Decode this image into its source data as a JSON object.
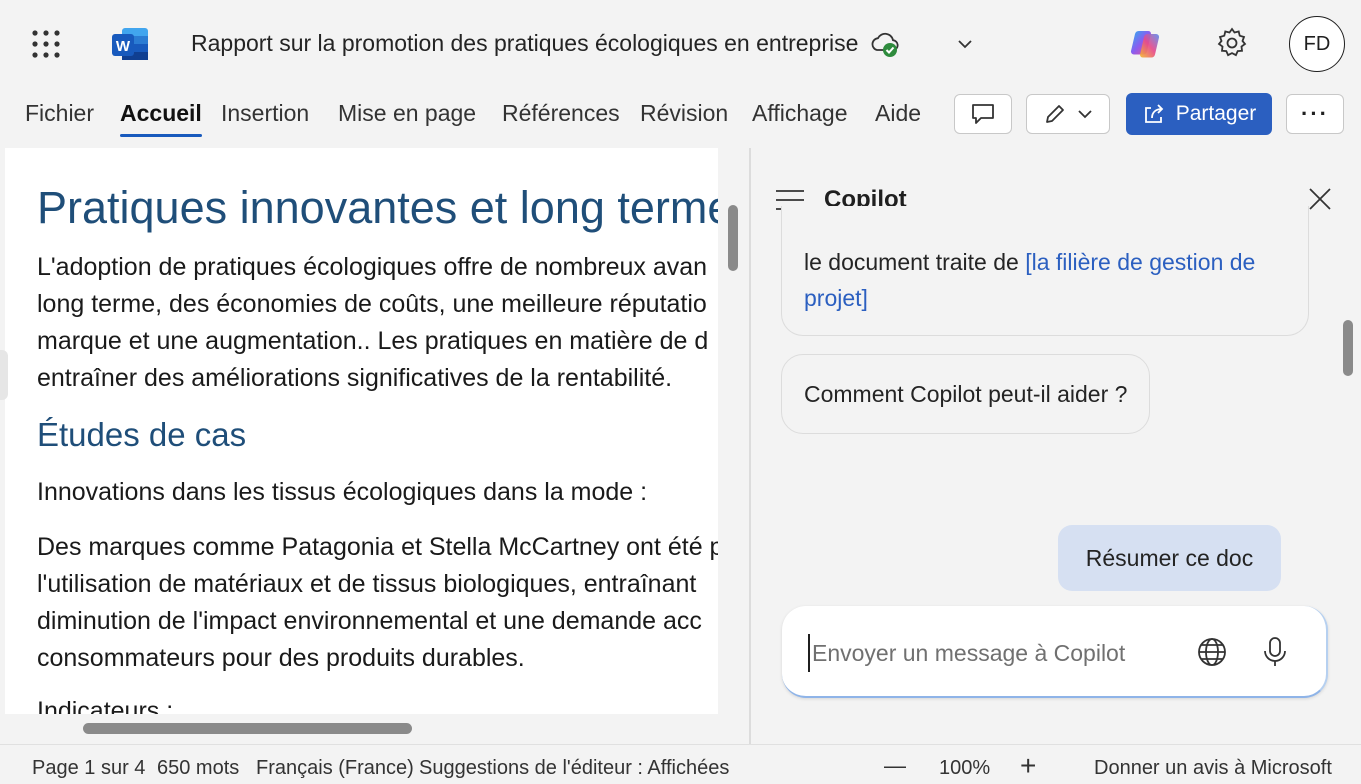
{
  "titlebar": {
    "document_title": "Rapport sur la promotion des pratiques écologiques en entreprise",
    "avatar_initials": "FD",
    "icons": [
      "app-launcher-icon",
      "word-logo-icon",
      "cloud-saved-icon",
      "chevron-down-icon",
      "copilot-icon",
      "gear-icon"
    ]
  },
  "ribbon": {
    "tabs": [
      "Fichier",
      "Accueil",
      "Insertion",
      "Mise en page",
      "Références",
      "Révision",
      "Affichage",
      "Aide"
    ],
    "active_tab": "Accueil",
    "share_label": "Partager",
    "more_label": "···"
  },
  "document": {
    "heading": "Pratiques innovantes et long terme...",
    "intro_lines": [
      "L'adoption de pratiques écologiques offre de nombreux avan",
      "long terme, des économies de coûts, une meilleure réputatio",
      "marque et une augmentation.. Les pratiques en matière de d",
      "entraîner des améliorations significatives de la rentabilité."
    ],
    "section_heading": "Études de cas",
    "subheading": "Innovations dans les tissus écologiques dans la mode :",
    "case_lines": [
      "Des marques comme Patagonia et Stella McCartney ont été p",
      "l'utilisation de matériaux et de tissus biologiques, entraînant",
      "diminution de l'impact environnemental et une demande acc",
      "consommateurs pour des produits durables."
    ],
    "next_heading_partial": "Indicateurs :"
  },
  "copilot": {
    "title": "Copilot",
    "response_text_prefix": "le document traite de ",
    "response_link": "[la filière de gestion de projet]",
    "suggestion_chip": "Comment Copilot peut-il aider ?",
    "user_message": "Résumer ce doc",
    "input_placeholder": "Envoyer un message à Copilot"
  },
  "statusbar": {
    "page": "Page 1 sur 4",
    "words": "650 mots",
    "language": "Français (France)",
    "editor_suggestions": "Suggestions de l'éditeur :  Affichées",
    "zoom_out": "—",
    "zoom": "100%",
    "zoom_in": "+",
    "feedback": "Donner un avis à Microsoft"
  },
  "colors": {
    "accent": "#2b5fc0",
    "heading": "#1f4e79",
    "user_bubble": "#d6e0f2",
    "background": "#f3f3f3"
  }
}
